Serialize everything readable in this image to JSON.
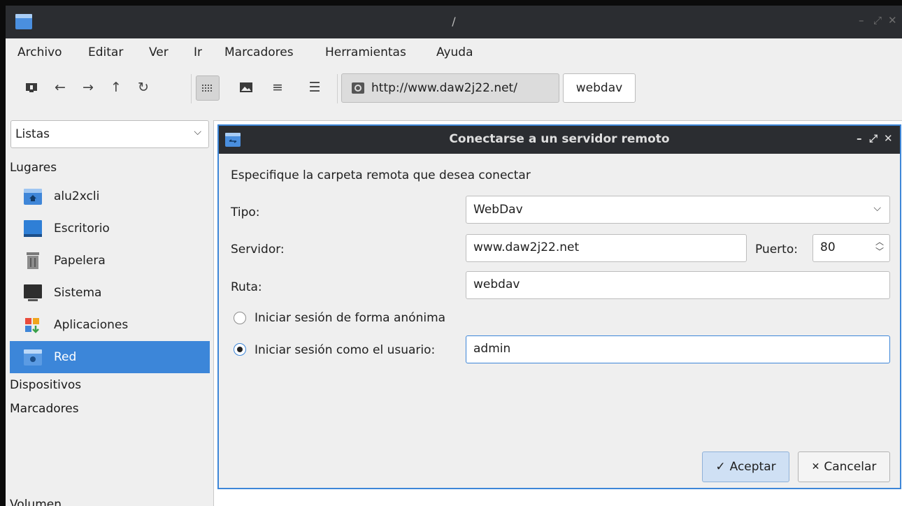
{
  "window": {
    "title": "/",
    "controls": {
      "minimize": "–",
      "maximize": "⤢",
      "close": "✕"
    }
  },
  "menubar": [
    "Archivo",
    "Editar",
    "Ver",
    "Ir",
    "Marcadores",
    "Herramientas",
    "Ayuda"
  ],
  "toolbar": {
    "buttons": [
      "new-window-icon",
      "back-arrow-icon",
      "forward-arrow-icon",
      "up-arrow-icon",
      "reload-icon",
      "icon-view-icon",
      "thumbnail-view-icon",
      "compact-view-icon",
      "detailed-list-view-icon"
    ],
    "path": {
      "current": "http://www.daw2j22.net/",
      "next": "webdav"
    }
  },
  "side_panel": {
    "mode": "Listas",
    "sections": {
      "places": "Lugares",
      "devices": "Dispositivos",
      "bookmarks": "Marcadores"
    },
    "places": [
      {
        "label": "alu2xcli",
        "icon": "home-folder-icon"
      },
      {
        "label": "Escritorio",
        "icon": "desktop-icon"
      },
      {
        "label": "Papelera",
        "icon": "trash-icon"
      },
      {
        "label": "Sistema",
        "icon": "computer-icon"
      },
      {
        "label": "Aplicaciones",
        "icon": "applications-icon"
      },
      {
        "label": "Red",
        "icon": "network-folder-icon",
        "selected": true
      }
    ],
    "bottom_text": "Volumen"
  },
  "dialog": {
    "title": "Conectarse a un servidor remoto",
    "controls": {
      "minimize": "–",
      "maximize": "⤢",
      "close": "✕"
    },
    "intro": "Especifique la carpeta remota que desea conectar",
    "type_label": "Tipo:",
    "type_value": "WebDav",
    "server_label": "Servidor:",
    "server_value": "www.daw2j22.net",
    "port_label": "Puerto:",
    "port_value": "80",
    "path_label": "Ruta:",
    "path_value": "webdav",
    "anon_label": "Iniciar sesión de forma anónima",
    "user_label": "Iniciar sesión como el usuario:",
    "user_value": "admin",
    "ok_label": "Aceptar",
    "cancel_label": "Cancelar"
  },
  "colors": {
    "accent": "#3c86d9",
    "titlebar": "#2b2d31"
  }
}
